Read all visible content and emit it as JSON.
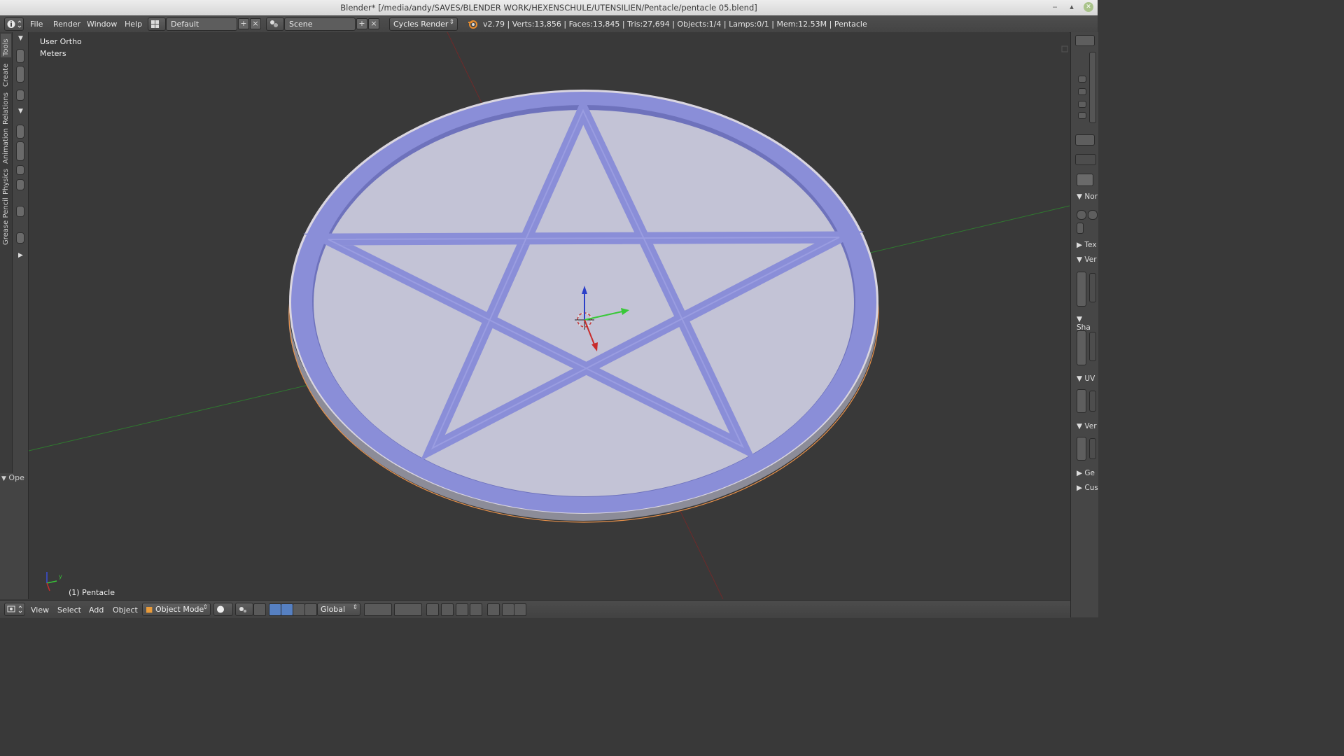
{
  "window": {
    "title": "Blender* [/media/andy/SAVES/BLENDER WORK/HEXENSCHULE/UTENSILIEN/Pentacle/pentacle 05.blend]",
    "minimize": "‒",
    "maximize": "▴",
    "close": "✕"
  },
  "topbar": {
    "menus": [
      "File",
      "Render",
      "Window",
      "Help"
    ],
    "layout": "Default",
    "scene": "Scene",
    "engine": "Cycles Render",
    "stats": "v2.79 | Verts:13,856 | Faces:13,845 | Tris:27,694 | Objects:1/4 | Lamps:0/1 | Mem:12.53M | Pentacle"
  },
  "toolshelf": {
    "tabs": [
      "Tools",
      "Create",
      "Relations",
      "Animation",
      "Physics",
      "Grease Pencil"
    ],
    "operator_panel": "Ope"
  },
  "viewport": {
    "view_name": "User Ortho",
    "units": "Meters",
    "active_object": "(1) Pentacle",
    "axis_y": "y"
  },
  "right_panel": {
    "sections": [
      "Nor",
      "Tex",
      "Ver",
      "Sha",
      "UV",
      "Ver",
      "Ge",
      "Cus"
    ]
  },
  "bottombar": {
    "menus": [
      "View",
      "Select",
      "Add",
      "Object"
    ],
    "mode": "Object Mode",
    "orientation": "Global"
  },
  "colors": {
    "viewport_bg": "#393939",
    "pentacle_face": "#c3c3d6",
    "pentacle_inlay": "#8a8ed8",
    "selection_outline": "#e8914a",
    "axis_x": "#7a2b2b",
    "axis_y": "#2f7a2f"
  }
}
